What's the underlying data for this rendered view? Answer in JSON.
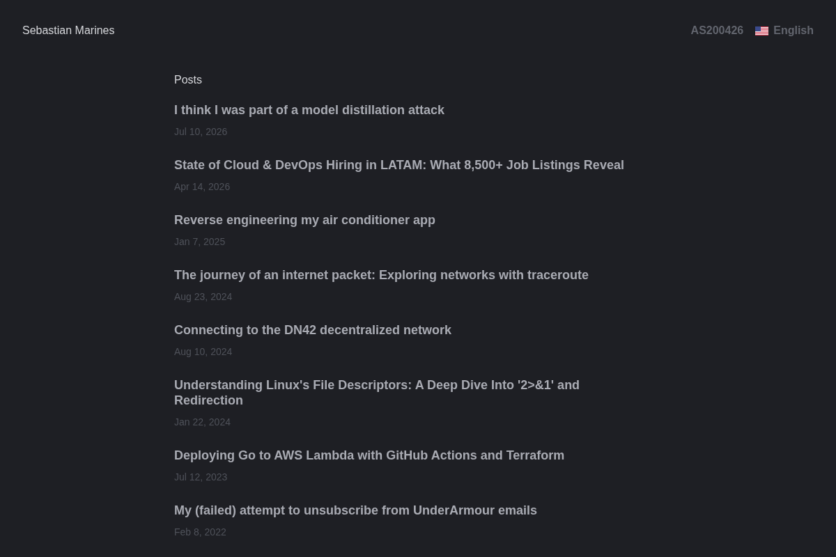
{
  "header": {
    "site_name": "Sebastian Marines",
    "asn": "AS200426",
    "language": "English"
  },
  "section": {
    "heading": "Posts"
  },
  "posts": [
    {
      "title": "I think I was part of a model distillation attack",
      "date": "Jul 10, 2026"
    },
    {
      "title": "State of Cloud & DevOps Hiring in LATAM: What 8,500+ Job Listings Reveal",
      "date": "Apr 14, 2026"
    },
    {
      "title": "Reverse engineering my air conditioner app",
      "date": "Jan 7, 2025"
    },
    {
      "title": "The journey of an internet packet: Exploring networks with traceroute",
      "date": "Aug 23, 2024"
    },
    {
      "title": "Connecting to the DN42 decentralized network",
      "date": "Aug 10, 2024"
    },
    {
      "title": "Understanding Linux's File Descriptors: A Deep Dive Into '2>&1' and Redirection",
      "date": "Jan 22, 2024"
    },
    {
      "title": "Deploying Go to AWS Lambda with GitHub Actions and Terraform",
      "date": "Jul 12, 2023"
    },
    {
      "title": "My (failed) attempt to unsubscribe from UnderArmour emails",
      "date": "Feb 8, 2022"
    }
  ]
}
